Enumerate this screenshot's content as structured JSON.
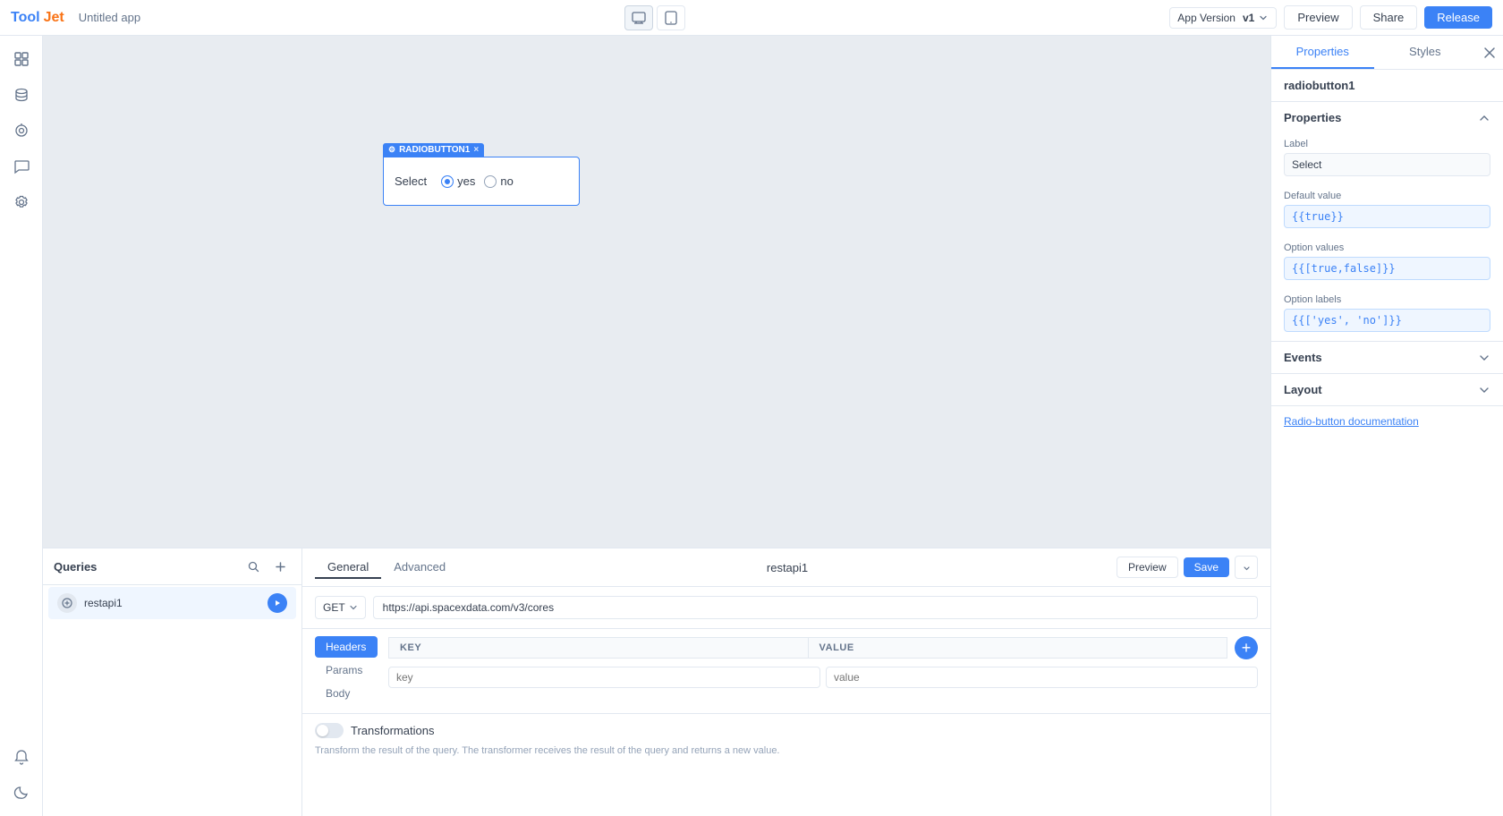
{
  "app": {
    "logo": "ToolJet",
    "title": "Untitled app"
  },
  "topnav": {
    "version_label": "App Version",
    "version": "v1",
    "preview_btn": "Preview",
    "share_btn": "Share",
    "release_btn": "Release"
  },
  "canvas": {
    "component": {
      "header": "RADIOBUTTON1",
      "label": "Select",
      "options": [
        "yes",
        "no"
      ],
      "checked_index": 0
    }
  },
  "right_panel": {
    "tabs": [
      "Properties",
      "Styles"
    ],
    "component_name": "radiobutton1",
    "properties_section": {
      "title": "Properties",
      "label_field": "Label",
      "label_value": "Select",
      "default_value_field": "Default value",
      "default_value": "{{true}}",
      "option_values_field": "Option values",
      "option_values": "{{[true,false]}}",
      "option_labels_field": "Option labels",
      "option_labels": "{{['yes', 'no']}}"
    },
    "events_section": "Events",
    "layout_section": "Layout",
    "doc_link": "Radio-button documentation"
  },
  "queries": {
    "title": "Queries",
    "items": [
      {
        "name": "restapi1",
        "type": "api"
      }
    ]
  },
  "query_editor": {
    "tabs": [
      "General",
      "Advanced"
    ],
    "active_tab": "General",
    "query_name": "restapi1",
    "preview_btn": "Preview",
    "save_btn": "Save",
    "method": "GET",
    "url": "https://api.spacexdata.com/v3/cores",
    "params_tabs": [
      "Headers",
      "Params",
      "Body"
    ],
    "active_params_tab": "Headers",
    "table": {
      "key_header": "KEY",
      "value_header": "VALUE",
      "key_placeholder": "key",
      "value_placeholder": "value"
    },
    "transformations_title": "Transformations",
    "transformations_desc": "Transform the result of the query. The transformer receives the result of the query and returns a new value."
  }
}
